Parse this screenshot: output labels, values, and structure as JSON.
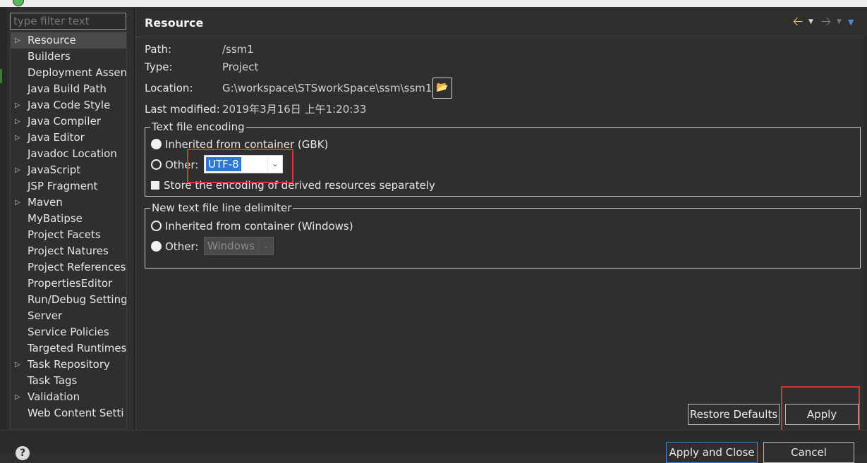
{
  "filter": {
    "placeholder": "type filter text"
  },
  "tree": {
    "items": [
      {
        "label": "Resource",
        "expandable": true,
        "selected": true
      },
      {
        "label": "Builders",
        "expandable": false
      },
      {
        "label": "Deployment Assen",
        "expandable": false
      },
      {
        "label": "Java Build Path",
        "expandable": false
      },
      {
        "label": "Java Code Style",
        "expandable": true
      },
      {
        "label": "Java Compiler",
        "expandable": true
      },
      {
        "label": "Java Editor",
        "expandable": true
      },
      {
        "label": "Javadoc Location",
        "expandable": false
      },
      {
        "label": "JavaScript",
        "expandable": true
      },
      {
        "label": "JSP Fragment",
        "expandable": false
      },
      {
        "label": "Maven",
        "expandable": true
      },
      {
        "label": "MyBatipse",
        "expandable": false
      },
      {
        "label": "Project Facets",
        "expandable": false
      },
      {
        "label": "Project Natures",
        "expandable": false
      },
      {
        "label": "Project References",
        "expandable": false
      },
      {
        "label": "PropertiesEditor",
        "expandable": false
      },
      {
        "label": "Run/Debug Setting",
        "expandable": false
      },
      {
        "label": "Server",
        "expandable": false
      },
      {
        "label": "Service Policies",
        "expandable": false
      },
      {
        "label": "Targeted Runtimes",
        "expandable": false
      },
      {
        "label": "Task Repository",
        "expandable": true
      },
      {
        "label": "Task Tags",
        "expandable": false
      },
      {
        "label": "Validation",
        "expandable": true
      },
      {
        "label": "Web Content Setti",
        "expandable": false
      }
    ]
  },
  "header": {
    "title": "Resource"
  },
  "info": {
    "path_label": "Path:",
    "path_value": "/ssm1",
    "type_label": "Type:",
    "type_value": "Project",
    "location_label": "Location:",
    "location_value": "G:\\workspace\\STSworkSpace\\ssm\\ssm1",
    "modified_label": "Last modified:",
    "modified_value": "2019年3月16日 上午1:20:33"
  },
  "encoding": {
    "legend": "Text file encoding",
    "inherited_label": "Inherited from container (GBK)",
    "other_label": "Other:",
    "other_value": "UTF-8",
    "store_label": "Store the encoding of derived resources separately"
  },
  "delimiter": {
    "legend": "New text file line delimiter",
    "inherited_label": "Inherited from container (Windows)",
    "other_label": "Other:",
    "other_value": "Windows"
  },
  "buttons": {
    "restore_defaults": "Restore Defaults",
    "apply": "Apply",
    "apply_and_close": "Apply and Close",
    "cancel": "Cancel"
  },
  "colors": {
    "accent": "#2b78d6",
    "highlight": "#e0302f",
    "nav_back": "#f3c33c"
  }
}
